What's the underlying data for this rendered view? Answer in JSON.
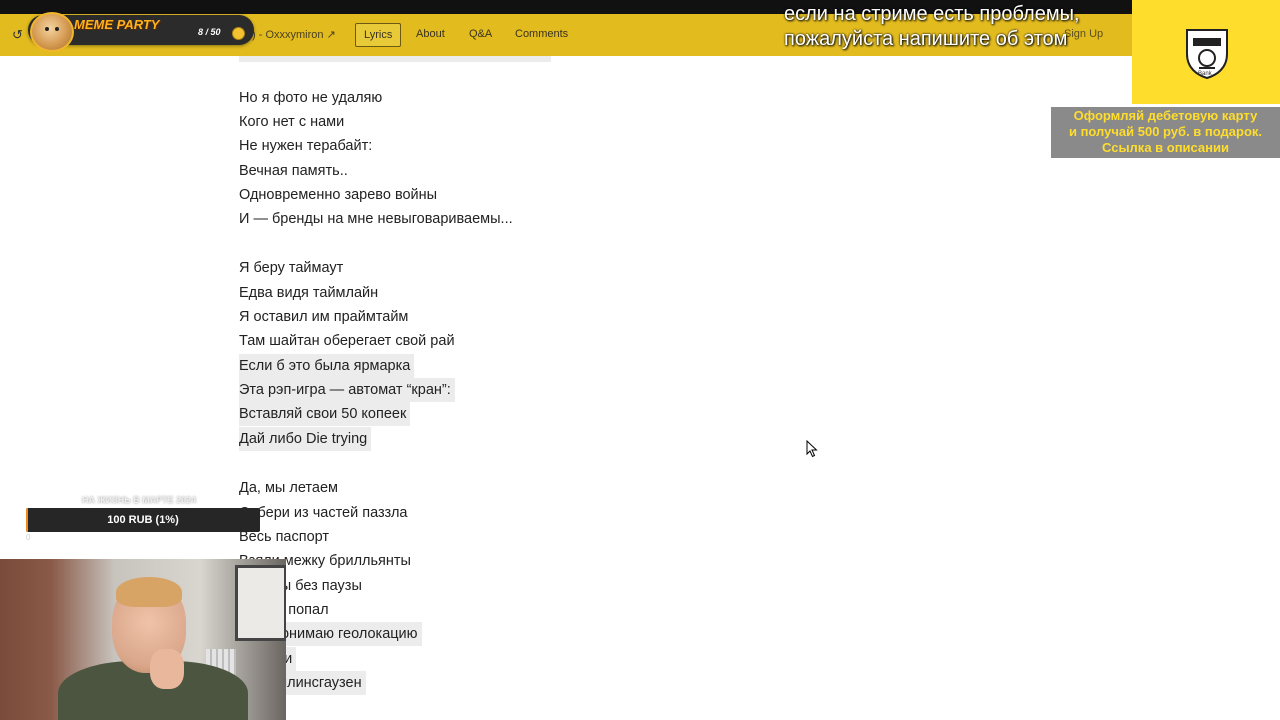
{
  "navbar": {
    "back_glyph": "↺",
    "song_title": ") - Oxxxymiron",
    "song_arrow": "↗",
    "tabs": [
      {
        "label": "Lyrics",
        "active": true
      },
      {
        "label": "About",
        "active": false
      },
      {
        "label": "Q&A",
        "active": false
      },
      {
        "label": "Comments",
        "active": false
      }
    ],
    "signup": "Sign Up",
    "color": "#e2bb1f"
  },
  "meme_widget": {
    "title": "MEME PARTY",
    "score": "8 / 50"
  },
  "stream_message": {
    "line1": "если на стриме есть проблемы,",
    "line2": "пожалуйста напишите об этом"
  },
  "bank_ad": {
    "brand": "Bank",
    "banner_lines": [
      "Оформляй дебетовую карту",
      "и получай 500 руб. в подарок.",
      "Ссылка в описании"
    ],
    "color": "#ffdd2d"
  },
  "lyrics": [
    {
      "text": "Но я фото не удаляю",
      "hl": false
    },
    {
      "text": "Кого нет с нами",
      "hl": false
    },
    {
      "text": "Не нужен терабайт:",
      "hl": false
    },
    {
      "text": "Вечная память..",
      "hl": false
    },
    {
      "text": "Одновременно зарево войны",
      "hl": false
    },
    {
      "text": "И — бренды на мне невыговариваемы...",
      "hl": false
    },
    {
      "text": "Я беру таймаут",
      "hl": false
    },
    {
      "text": "Едва видя таймлайн",
      "hl": false
    },
    {
      "text": "Я оставил им праймтайм",
      "hl": false
    },
    {
      "text": "Там шайтан оберегает свой рай",
      "hl": false
    },
    {
      "text": "Если б это была ярмарка",
      "hl": true
    },
    {
      "text": "Эта рэп-игра — автомат “кран”:",
      "hl": true
    },
    {
      "text": "Вставляй свои 50 копеек",
      "hl": true
    },
    {
      "text": "Дай либо Die trying",
      "hl": true
    },
    {
      "text": "Да, мы летаем",
      "hl": false
    },
    {
      "text": "Собери из частей паззла",
      "hl": false
    },
    {
      "text": "Весь паспорт",
      "hl": false
    },
    {
      "text": "Взяли межку брилльянты",
      "hl": false
    },
    {
      "text": "Ибарсы без паузы",
      "hl": false
    },
    {
      "text": ", ты не попал",
      "hl": false
    },
    {
      "text": "м не понимаю геолокацию",
      "hl": true
    },
    {
      "text": "е земли",
      "hl": true
    },
    {
      "text": "ый Беллинсгаузен",
      "hl": true
    }
  ],
  "donation_goal": {
    "title": "НА ЖИЗНЬ В МАРТЕ 2024",
    "amount": "100 RUB (1%)",
    "progress_percent": 1,
    "start": "0",
    "fill_color": "#f08a1c"
  }
}
